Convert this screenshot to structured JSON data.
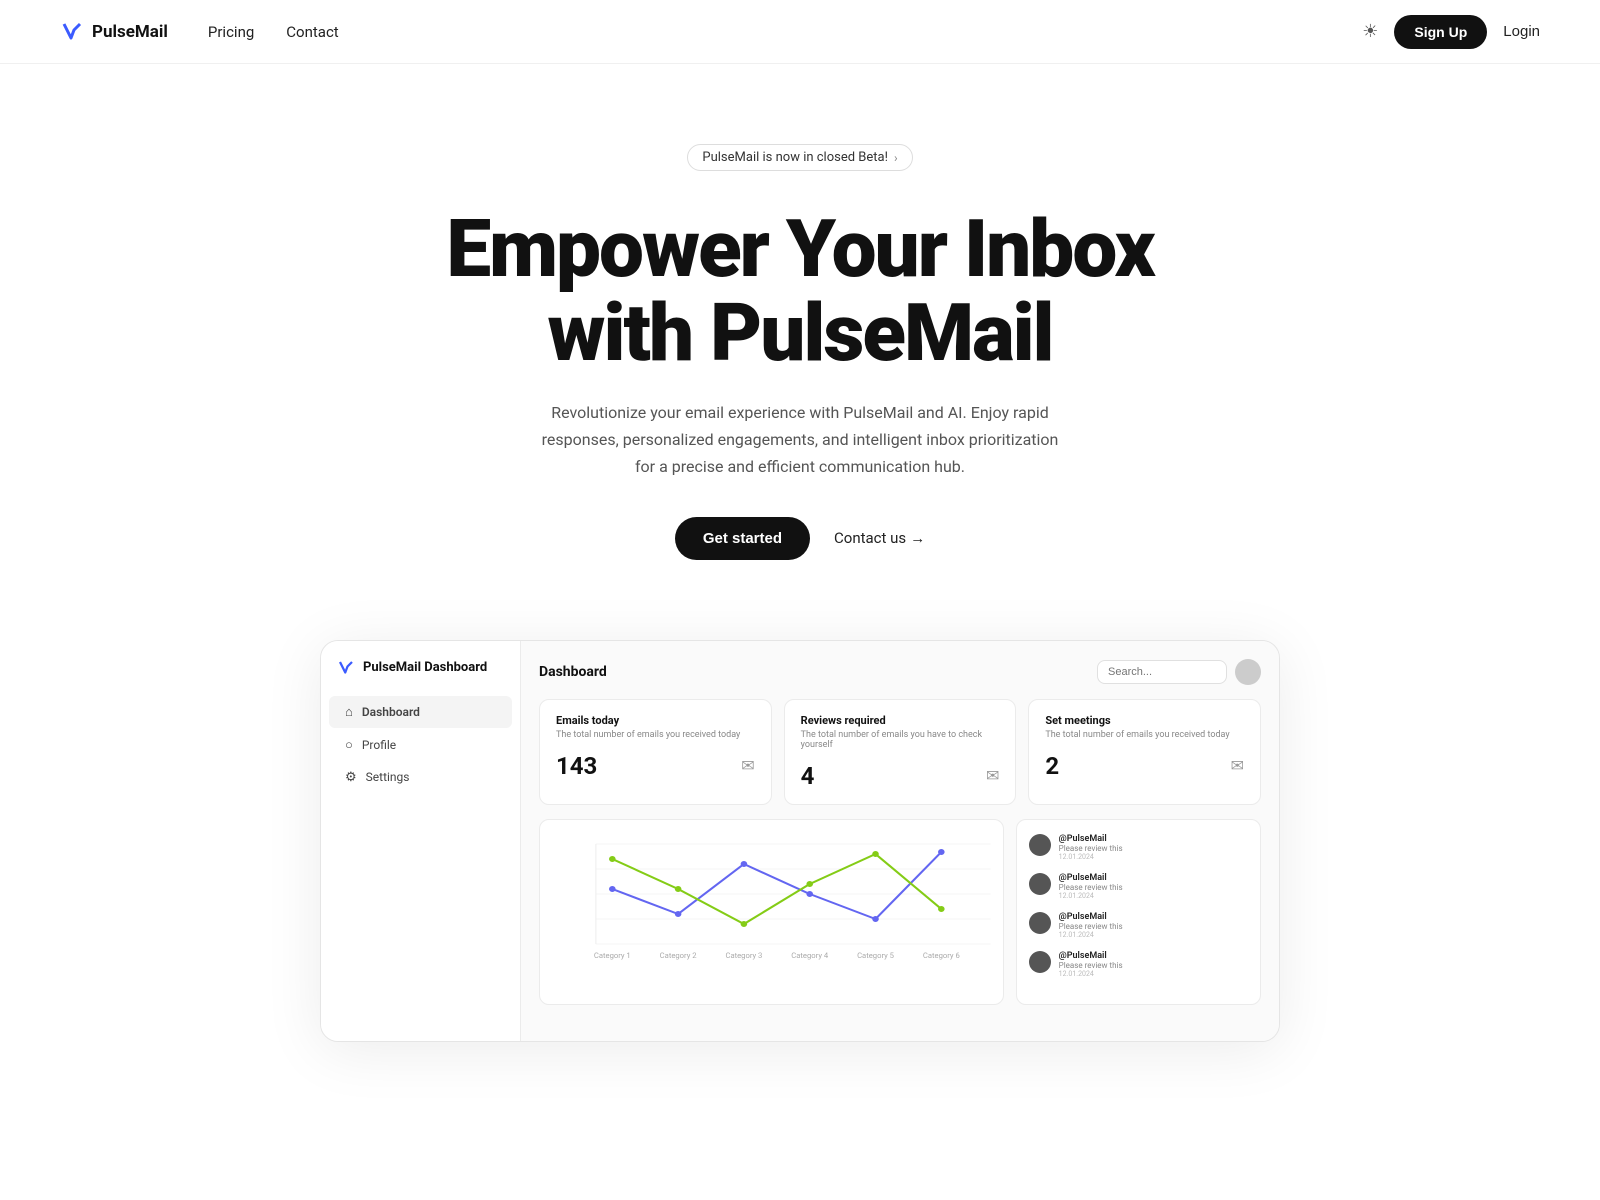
{
  "nav": {
    "brand": "PulseMail",
    "links": [
      "Pricing",
      "Contact"
    ],
    "signup_label": "Sign Up",
    "login_label": "Login",
    "theme_icon": "☀"
  },
  "hero": {
    "beta_badge": "PulseMail is now in closed Beta!",
    "headline_line1": "Empower Your Inbox",
    "headline_line2": "with PulseMail",
    "subtitle": "Revolutionize your email experience with PulseMail and AI. Enjoy rapid responses, personalized engagements, and intelligent inbox prioritization for a precise and efficient communication hub.",
    "cta_primary": "Get started",
    "cta_secondary": "Contact us"
  },
  "dashboard": {
    "title": "Dashboard",
    "search_placeholder": "Search...",
    "sidebar_brand": "PulseMail Dashboard",
    "sidebar_items": [
      {
        "label": "Dashboard",
        "icon": "⌂",
        "active": true
      },
      {
        "label": "Profile",
        "icon": "○"
      },
      {
        "label": "Settings",
        "icon": "⚙"
      }
    ],
    "stats": [
      {
        "title": "Emails today",
        "subtitle": "The total number of emails you received today",
        "value": "143",
        "icon": "✉"
      },
      {
        "title": "Reviews required",
        "subtitle": "The total number of emails you have to check yourself",
        "value": "4",
        "icon": "✉"
      },
      {
        "title": "Set meetings",
        "subtitle": "The total number of emails you received today",
        "value": "2",
        "icon": "✉"
      }
    ],
    "chart": {
      "x_labels": [
        "Category 1",
        "Category 2",
        "Category 3",
        "Category 4",
        "Category 5",
        "Category 6"
      ],
      "series": [
        {
          "color": "#6366f1",
          "points": [
            [
              0,
              60
            ],
            [
              1,
              40
            ],
            [
              2,
              75
            ],
            [
              3,
              55
            ],
            [
              4,
              35
            ],
            [
              5,
              80
            ]
          ]
        },
        {
          "color": "#84cc16",
          "points": [
            [
              0,
              80
            ],
            [
              1,
              65
            ],
            [
              2,
              50
            ],
            [
              3,
              70
            ],
            [
              4,
              90
            ],
            [
              5,
              55
            ]
          ]
        }
      ]
    },
    "email_list": [
      {
        "sender": "@PulseMail",
        "msg": "Please review this",
        "date": "12.01.2024"
      },
      {
        "sender": "@PulseMail",
        "msg": "Please review this",
        "date": "12.01.2024"
      },
      {
        "sender": "@PulseMail",
        "msg": "Please review this",
        "date": "12.01.2024"
      },
      {
        "sender": "@PulseMail",
        "msg": "Please review this",
        "date": "12.01.2024"
      }
    ]
  }
}
